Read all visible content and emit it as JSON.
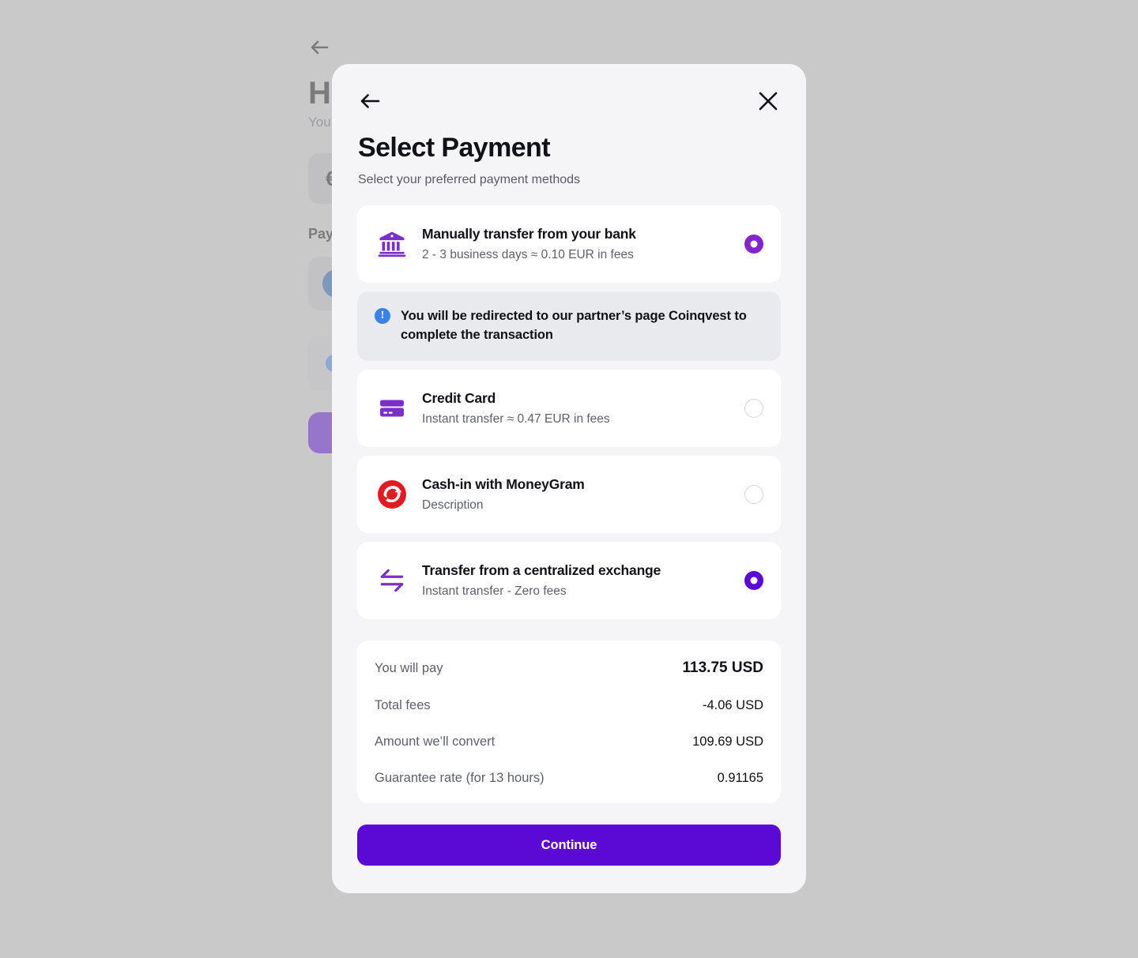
{
  "background_page": {
    "back_icon": "arrow-left-icon",
    "title": "Ho",
    "subtitle": "You",
    "currency_chip": "€",
    "section_label": "Pay",
    "continue_button": ""
  },
  "modal": {
    "back_icon": "arrow-left-icon",
    "close_icon": "close-icon",
    "title": "Select Payment",
    "subtitle": "Select your preferred payment methods",
    "payment_methods": [
      {
        "icon": "bank-icon",
        "title": "Manually transfer from your bank",
        "description": "2 - 3 business days ≈ 0.10 EUR in  fees",
        "selected": true,
        "radio_style": "sel-a"
      },
      {
        "icon": "credit-card-icon",
        "title": "Credit Card",
        "description": "Instant transfer  ≈ 0.47 EUR in fees",
        "selected": false,
        "radio_style": ""
      },
      {
        "icon": "moneygram-logo-icon",
        "title": "Cash-in with MoneyGram",
        "description": "Description",
        "selected": false,
        "radio_style": ""
      },
      {
        "icon": "exchange-arrows-icon",
        "title": "Transfer from a centralized exchange",
        "description": "Instant transfer  - Zero fees",
        "selected": true,
        "radio_style": "sel-b"
      }
    ],
    "notice": {
      "icon": "info-icon",
      "text": "You will be redirected to our partner’s page Coinqvest to complete the transaction"
    },
    "summary": [
      {
        "label": "You will pay",
        "value": "113.75 USD",
        "primary": true
      },
      {
        "label": "Total fees",
        "value": "-4.06 USD",
        "primary": false
      },
      {
        "label": "Amount we’ll convert",
        "value": "109.69 USD",
        "primary": false
      },
      {
        "label": "Guarantee rate (for 13 hours)",
        "value": "0.91165",
        "primary": false
      }
    ],
    "continue_label": "Continue"
  },
  "colors": {
    "accent": "#5b0ad6",
    "accent_muted": "#8226c9",
    "icon_purple": "#7b2ec9",
    "info_blue": "#3b82e8",
    "moneygram_red": "#e01b22",
    "backdrop": "#c9c9c9"
  }
}
